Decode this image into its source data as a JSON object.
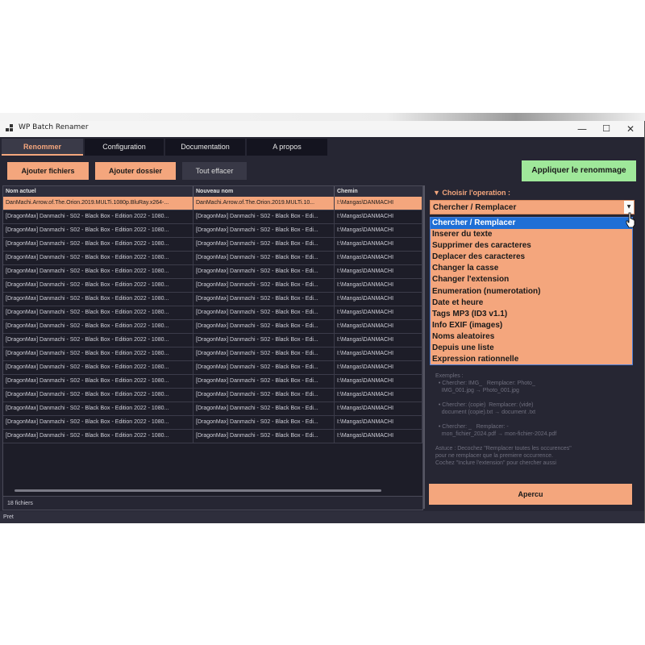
{
  "window": {
    "title": "WP Batch Renamer",
    "controls": {
      "minimize": "—",
      "maximize": "☐",
      "close": "✕"
    }
  },
  "tabs": [
    {
      "label": "Renommer",
      "active": true
    },
    {
      "label": "Configuration",
      "active": false
    },
    {
      "label": "Documentation",
      "active": false
    },
    {
      "label": "A propos",
      "active": false
    }
  ],
  "toolbar": {
    "add_files": "Ajouter fichiers",
    "add_folder": "Ajouter dossier",
    "clear_all": "Tout effacer",
    "apply": "Appliquer le renommage"
  },
  "table": {
    "columns": [
      "Nom actuel",
      "Nouveau nom",
      "Chemin"
    ],
    "rows": [
      [
        "DanMachi.Arrow.of.The.Orion.2019.MULTi.1080p.BluRay.x264-...",
        "DanMachi.Arrow.of.The.Orion.2019.MULTi.10...",
        "I:\\Mangas\\DANMACHI"
      ],
      [
        "[DragonMax] Danmachi - S02 - Black Box - Edition 2022 - 1080...",
        "[DragonMax] Danmachi - S02 - Black Box - Edi...",
        "I:\\Mangas\\DANMACHI"
      ],
      [
        "[DragonMax] Danmachi - S02 - Black Box - Edition 2022 - 1080...",
        "[DragonMax] Danmachi - S02 - Black Box - Edi...",
        "I:\\Mangas\\DANMACHI"
      ],
      [
        "[DragonMax] Danmachi - S02 - Black Box - Edition 2022 - 1080...",
        "[DragonMax] Danmachi - S02 - Black Box - Edi...",
        "I:\\Mangas\\DANMACHI"
      ],
      [
        "[DragonMax] Danmachi - S02 - Black Box - Edition 2022 - 1080...",
        "[DragonMax] Danmachi - S02 - Black Box - Edi...",
        "I:\\Mangas\\DANMACHI"
      ],
      [
        "[DragonMax] Danmachi - S02 - Black Box - Edition 2022 - 1080...",
        "[DragonMax] Danmachi - S02 - Black Box - Edi...",
        "I:\\Mangas\\DANMACHI"
      ],
      [
        "[DragonMax] Danmachi - S02 - Black Box - Edition 2022 - 1080...",
        "[DragonMax] Danmachi - S02 - Black Box - Edi...",
        "I:\\Mangas\\DANMACHI"
      ],
      [
        "[DragonMax] Danmachi - S02 - Black Box - Edition 2022 - 1080...",
        "[DragonMax] Danmachi - S02 - Black Box - Edi...",
        "I:\\Mangas\\DANMACHI"
      ],
      [
        "[DragonMax] Danmachi - S02 - Black Box - Edition 2022 - 1080...",
        "[DragonMax] Danmachi - S02 - Black Box - Edi...",
        "I:\\Mangas\\DANMACHI"
      ],
      [
        "[DragonMax] Danmachi - S02 - Black Box - Edition 2022 - 1080...",
        "[DragonMax] Danmachi - S02 - Black Box - Edi...",
        "I:\\Mangas\\DANMACHI"
      ],
      [
        "[DragonMax] Danmachi - S02 - Black Box - Edition 2022 - 1080...",
        "[DragonMax] Danmachi - S02 - Black Box - Edi...",
        "I:\\Mangas\\DANMACHI"
      ],
      [
        "[DragonMax] Danmachi - S02 - Black Box - Edition 2022 - 1080...",
        "[DragonMax] Danmachi - S02 - Black Box - Edi...",
        "I:\\Mangas\\DANMACHI"
      ],
      [
        "[DragonMax] Danmachi - S02 - Black Box - Edition 2022 - 1080...",
        "[DragonMax] Danmachi - S02 - Black Box - Edi...",
        "I:\\Mangas\\DANMACHI"
      ],
      [
        "[DragonMax] Danmachi - S02 - Black Box - Edition 2022 - 1080...",
        "[DragonMax] Danmachi - S02 - Black Box - Edi...",
        "I:\\Mangas\\DANMACHI"
      ],
      [
        "[DragonMax] Danmachi - S02 - Black Box - Edition 2022 - 1080...",
        "[DragonMax] Danmachi - S02 - Black Box - Edi...",
        "I:\\Mangas\\DANMACHI"
      ],
      [
        "[DragonMax] Danmachi - S02 - Black Box - Edition 2022 - 1080...",
        "[DragonMax] Danmachi - S02 - Black Box - Edi...",
        "I:\\Mangas\\DANMACHI"
      ],
      [
        "[DragonMax] Danmachi - S02 - Black Box - Edition 2022 - 1080...",
        "[DragonMax] Danmachi - S02 - Black Box - Edi...",
        "I:\\Mangas\\DANMACHI"
      ],
      [
        "[DragonMax] Danmachi - S02 - Black Box - Edition 2022 - 1080...",
        "[DragonMax] Danmachi - S02 - Black Box - Edi...",
        "I:\\Mangas\\DANMACHI"
      ]
    ],
    "selected_row": 0,
    "file_count": "18 fichiers"
  },
  "operation": {
    "title": "▼ Choisir l'operation :",
    "selected": "Chercher / Remplacer",
    "arrow": "▼",
    "options": [
      "Chercher / Remplacer",
      "Inserer du texte",
      "Supprimer des caracteres",
      "Deplacer des caracteres",
      "Changer la casse",
      "Changer l'extension",
      "Enumeration (numerotation)",
      "Date et heure",
      "Tags MP3 (ID3 v1.1)",
      "Info EXIF (images)",
      "Noms aleatoires",
      "Depuis une liste",
      "Expression rationnelle"
    ]
  },
  "help": {
    "lines": [
      "Exemples :",
      "  • Chercher: IMG_   Remplacer: Photo_",
      "    IMG_001.jpg → Photo_001.jpg",
      "",
      "  • Chercher: (copie)  Remplacer: (vide)",
      "    document (copie).txt → document .txt",
      "",
      "  • Chercher: _   Remplacer: -",
      "    mon_fichier_2024.pdf → mon-fichier-2024.pdf",
      "",
      "Astuce : Decochez \"Remplacer toutes les occurences\"",
      "pour ne remplacer que la premiere occurrence.",
      "Cochez \"Inclure l'extension\" pour chercher aussi"
    ]
  },
  "preview_button": "Apercu",
  "status": "Pret",
  "colors": {
    "accent": "#f4a67d",
    "apply": "#9fe89a",
    "background": "#262633",
    "selection": "#1f6fd6"
  }
}
